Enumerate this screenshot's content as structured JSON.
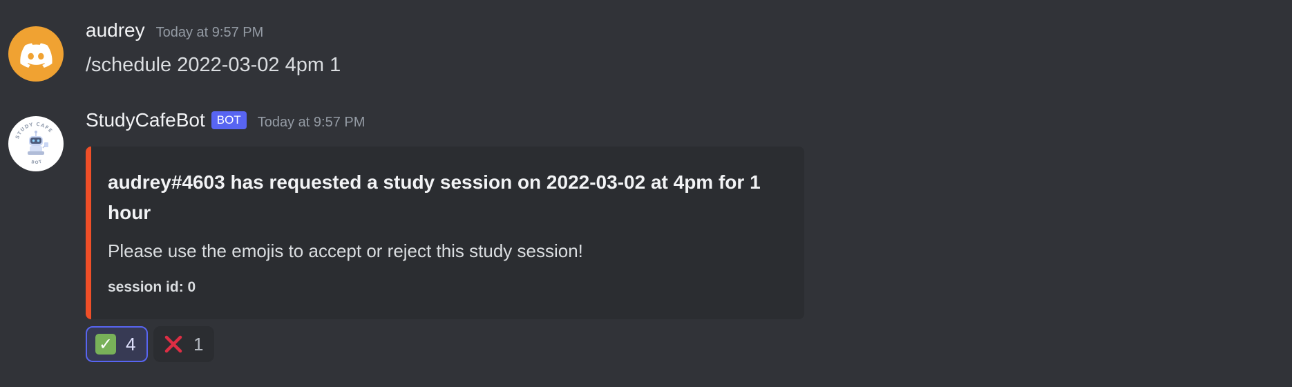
{
  "messages": [
    {
      "username": "audrey",
      "timestamp": "Today at 9:57 PM",
      "content": "/schedule 2022-03-02 4pm 1",
      "avatar": {
        "icon": "discord-logo-icon",
        "color": "#f0a232"
      }
    },
    {
      "username": "StudyCafeBot",
      "bot_tag": "BOT",
      "timestamp": "Today at 9:57 PM",
      "avatar": {
        "icon": "study-cafe-robot-logo",
        "text": "STUDY CAFE BOT",
        "color": "#ffffff"
      },
      "embed": {
        "accent_color": "#ef4f28",
        "title": "audrey#4603 has requested a study session on 2022-03-02 at 4pm for 1 hour",
        "description": "Please use the emojis to accept or reject this study session!",
        "field": "session id: 0"
      },
      "reactions": [
        {
          "emoji": "white-check-mark-icon",
          "count": "4",
          "active": true
        },
        {
          "emoji": "cross-mark-icon",
          "count": "1",
          "active": false
        }
      ]
    }
  ],
  "colors": {
    "background": "#313338",
    "embed_background": "#2b2d31",
    "blurple": "#5865f2",
    "timestamp": "#949ba4"
  }
}
